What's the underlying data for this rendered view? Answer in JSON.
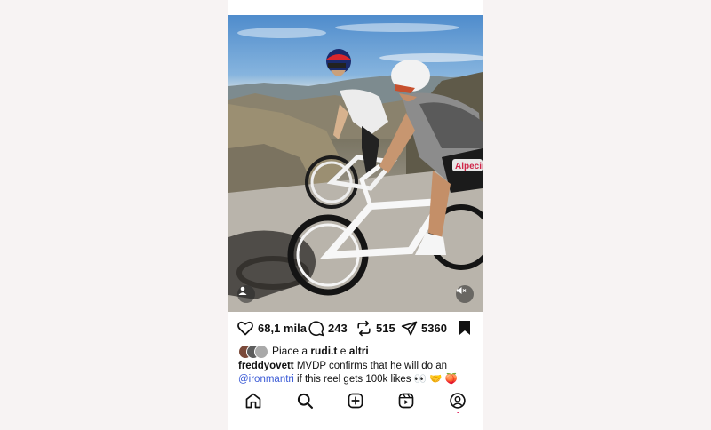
{
  "post": {
    "likes_count": "68,1 mila",
    "comments_count": "243",
    "reposts_count": "515",
    "shares_count": "5360",
    "liked_by_prefix": "Piace a",
    "liked_by_user": "rudi.t",
    "liked_by_joiner": "e",
    "liked_by_others": "altri",
    "caption_user": "freddyovett",
    "caption_text_1": "MVDP confirms that he will do an",
    "caption_mention": "@ironmantri",
    "caption_text_2": "if this reel gets 100k likes 👀 🤝 🍑",
    "jersey_text": "Alpecin"
  },
  "icons": {
    "like": "heart-icon",
    "comment": "comment-icon",
    "repost": "repost-icon",
    "share": "send-icon",
    "save": "bookmark-icon",
    "tag": "person-tag-icon",
    "mute": "mute-icon",
    "home": "home-icon",
    "search": "search-icon",
    "create": "plus-square-icon",
    "reels": "reels-icon",
    "profile": "profile-icon"
  },
  "colors": {
    "mention": "#3b5bd6",
    "notification_dot": "#e0245e",
    "side_background": "#f7f3f3"
  }
}
